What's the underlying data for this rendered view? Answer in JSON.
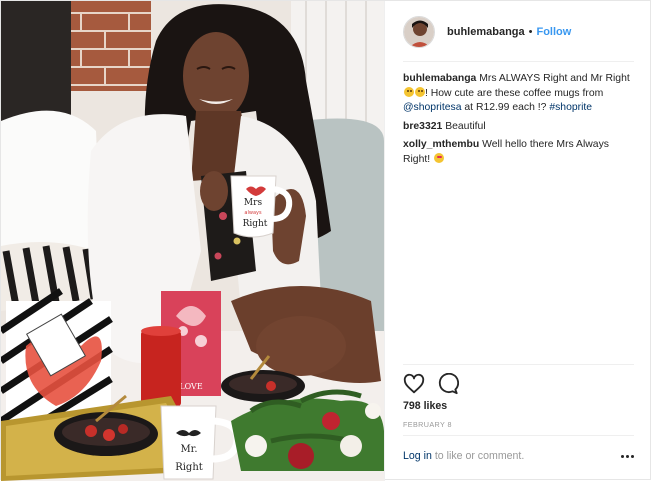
{
  "post": {
    "username": "buhlemabanga",
    "separator": "•",
    "follow_label": "Follow",
    "caption": {
      "username": "buhlemabanga",
      "text_before_emoji": "Mrs ALWAYS Right and Mr Right",
      "text_after_emoji": "! How cute are these coffee mugs from",
      "mention": "@shopritesa",
      "text_after_mention": "at R12.99 each !?",
      "hashtag": "#shoprite"
    },
    "comments": [
      {
        "username": "bre3321",
        "text": "Beautiful"
      },
      {
        "username": "xolly_mthembu",
        "text": "Well hello there Mrs Always Right!"
      }
    ],
    "likes": "798 likes",
    "date": "FEBRUARY 8",
    "login_link": "Log in",
    "login_suffix": "to like or comment.",
    "photo_text": {
      "mug_mrs_line1": "Mrs",
      "mug_mrs_line2": "always",
      "mug_mrs_line3": "Right",
      "mug_mr_line1": "Mr.",
      "mug_mr_line2": "Right",
      "card_text": "LOVE"
    }
  },
  "icons": {
    "like": "heart-icon",
    "comment": "comment-icon",
    "more": "more-options-icon"
  },
  "colors": {
    "link": "#3897f0",
    "mention": "#003569",
    "muted": "#999999",
    "text": "#262626"
  }
}
